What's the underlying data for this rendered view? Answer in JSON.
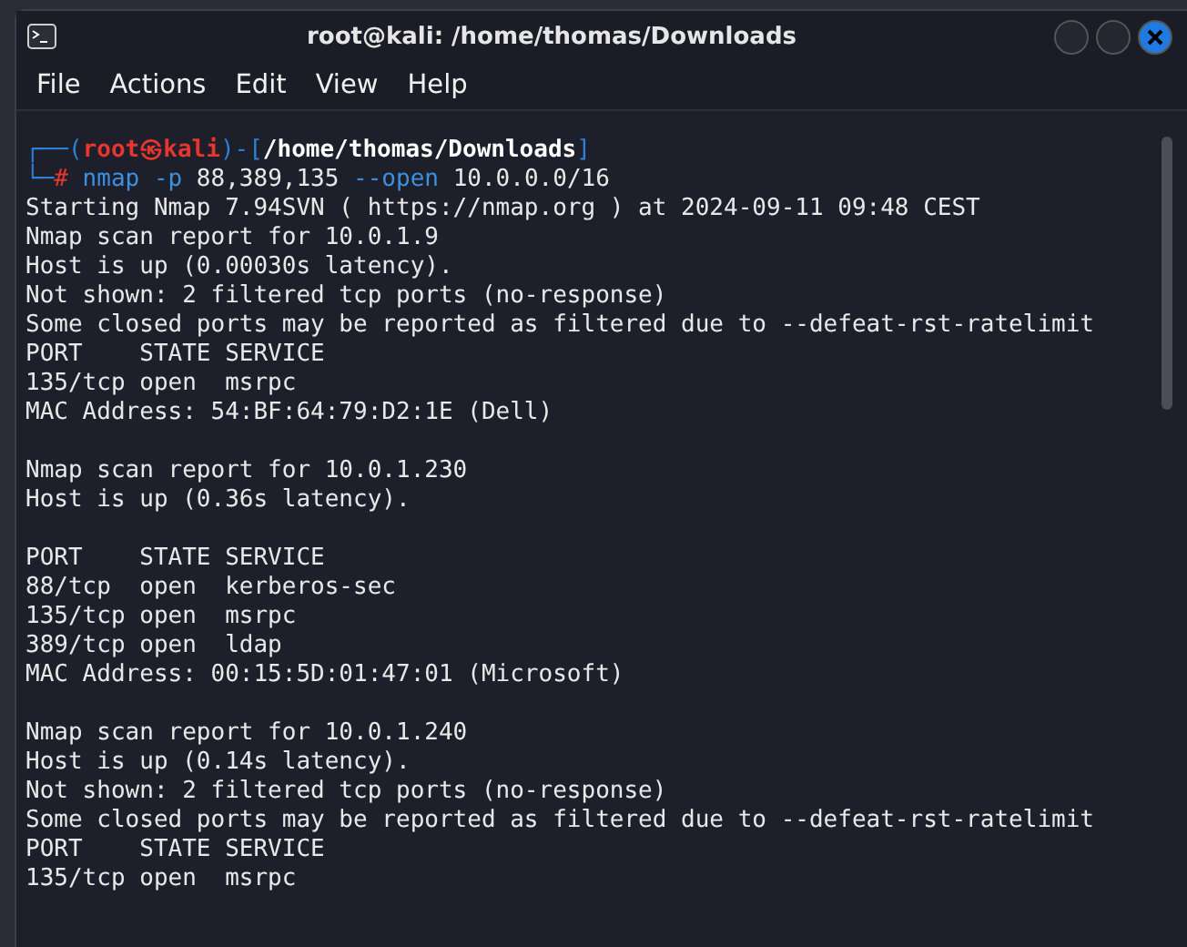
{
  "window": {
    "title": "root@kali: /home/thomas/Downloads"
  },
  "menu": [
    "File",
    "Actions",
    "Edit",
    "View",
    "Help"
  ],
  "terminal": {
    "prompt": [
      {
        "kind": "frame",
        "text": "┌──("
      },
      {
        "kind": "user",
        "text": "root㉿kali"
      },
      {
        "kind": "frame",
        "text": ")-["
      },
      {
        "kind": "path",
        "text": "/home/thomas/Downloads"
      },
      {
        "kind": "frame",
        "text": "]"
      }
    ],
    "command": [
      {
        "kind": "frame",
        "text": "└─"
      },
      {
        "kind": "hash",
        "text": "#"
      },
      {
        "kind": "program",
        "text": "nmap"
      },
      {
        "kind": "option",
        "text": "-p"
      },
      {
        "kind": "argument",
        "text": "88,389,135"
      },
      {
        "kind": "option",
        "text": "--open"
      },
      {
        "kind": "argument",
        "text": "10.0.0.0/16"
      }
    ],
    "output": [
      [
        "Starting Nmap 7.94SVN ( https://nmap.org ) at 2024-09-11 09:48 CEST",
        "Nmap scan report for 10.0.1.9",
        "Host is up (0.00030s latency).",
        "Not shown: 2 filtered tcp ports (no-response)",
        "Some closed ports may be reported as filtered due to --defeat-rst-ratelimit",
        "PORT    STATE SERVICE",
        "135/tcp open  msrpc",
        "MAC Address: 54:BF:64:79:D2:1E (Dell)"
      ],
      [
        "Nmap scan report for 10.0.1.230",
        "Host is up (0.36s latency)."
      ],
      [
        "PORT    STATE SERVICE",
        "88/tcp  open  kerberos-sec",
        "135/tcp open  msrpc",
        "389/tcp open  ldap",
        "MAC Address: 00:15:5D:01:47:01 (Microsoft)"
      ],
      [
        "Nmap scan report for 10.0.1.240",
        "Host is up (0.14s latency).",
        "Not shown: 2 filtered tcp ports (no-response)",
        "Some closed ports may be reported as filtered due to --defeat-rst-ratelimit",
        "PORT    STATE SERVICE",
        "135/tcp open  msrpc"
      ]
    ]
  }
}
